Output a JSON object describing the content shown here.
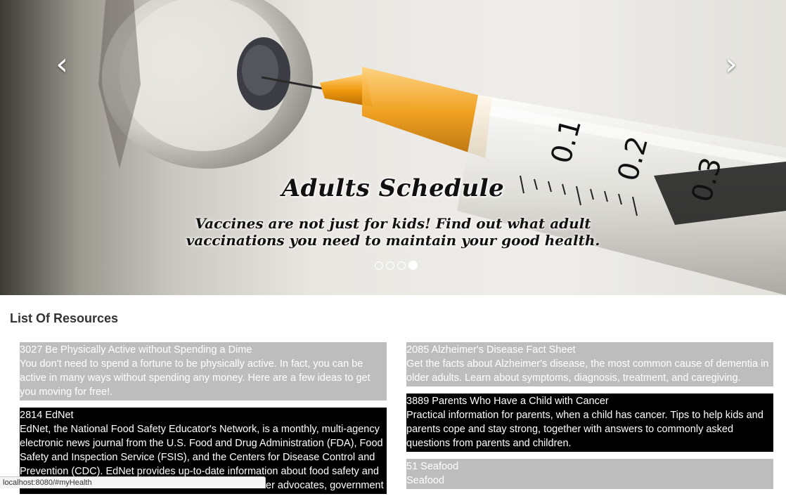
{
  "carousel": {
    "prev_icon": "chevron-left-icon",
    "next_icon": "chevron-right-icon",
    "prev_glyph": "‹",
    "next_glyph": "›",
    "caption_title": "Adults Schedule",
    "caption_text": "Vaccines are not just for kids! Find out what adult vaccinations you need to maintain your good health.",
    "indicator_count": 4,
    "active_indicator": 4
  },
  "resources": {
    "heading": "List Of Resources",
    "left": [
      {
        "title": "3027 Be Physically Active without Spending a Dime",
        "description": "You don't need to spend a fortune to be physically active. In fact, you can be active in many ways without spending any money. Here are a few ideas to get you moving for free!.",
        "style": "gray"
      },
      {
        "title": "2814 EdNet",
        "description": "EdNet, the National Food Safety Educator's Network, is a monthly, multi-agency electronic news journal from the U.S. Food and Drug Administration (FDA), Food Safety and Inspection Service (FSIS), and the Centers for Disease Control and Prevention (CDC). EdNet provides up-to-date information about food safety and",
        "tail": "er advocates, government",
        "style": "black"
      }
    ],
    "right": [
      {
        "title": "2085 Alzheimer's Disease Fact Sheet",
        "description": "Get the facts about Alzheimer's disease, the most common cause of dementia in older adults. Learn about symptoms, diagnosis, treatment, and caregiving.",
        "style": "gray"
      },
      {
        "title": "3889 Parents Who Have a Child with Cancer",
        "description": "Practical information for parents, when a child has cancer. Tips to help kids and parents cope and stay strong, together with answers to commonly asked questions from parents and children.",
        "style": "black"
      },
      {
        "title": "51 Seafood",
        "description": "Seafood",
        "style": "gray"
      }
    ]
  },
  "status_bar": {
    "url": "localhost:8080/#myHealth"
  },
  "colors": {
    "card_gray": "#bdbdbd",
    "card_black": "#000000",
    "syringe_orange": "#f0a020"
  }
}
